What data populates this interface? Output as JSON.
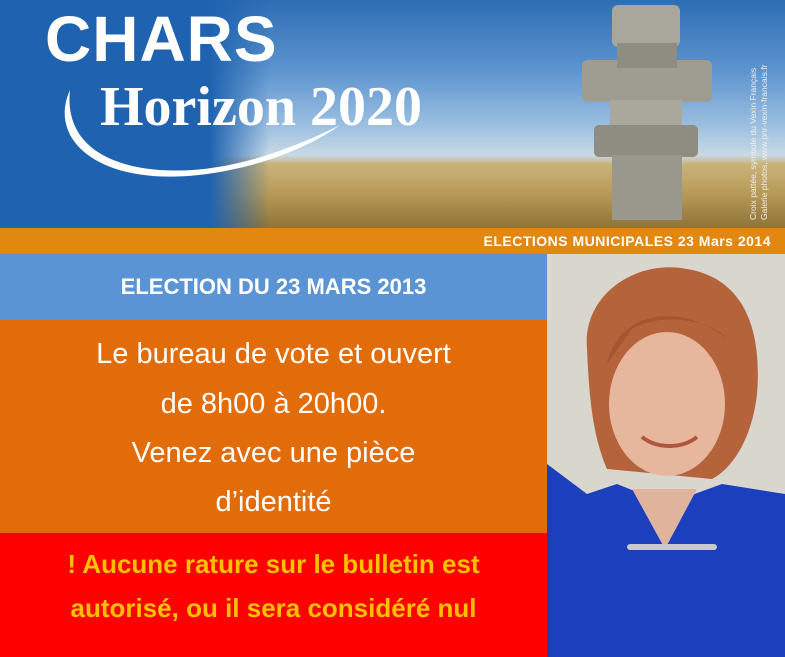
{
  "banner": {
    "brand_top": "CHARS",
    "brand_bottom": "Horizon 2020",
    "credit_line1": "Croix pattée, symbole du Vexin Français",
    "credit_line2": "Galerie photos, www.pnr-vexin-francais.fr"
  },
  "strip": {
    "text": "ELECTIONS MUNICIPALES 23 Mars 2014"
  },
  "title": {
    "text": "ELECTION DU 23 MARS 2013"
  },
  "info": {
    "lines": [
      "Le bureau de vote et ouvert",
      "de 8h00 à 20h00.",
      "Venez avec  une pièce",
      "d’identité"
    ]
  },
  "warning": {
    "lines": [
      "! Aucune rature sur le bulletin est",
      "autorisé, ou il sera considéré nul"
    ]
  },
  "colors": {
    "banner_blue": "#1f63b0",
    "strip_orange": "#e28710",
    "title_blue": "#5b94d5",
    "info_orange": "#e36c0a",
    "warning_red": "#fe0000",
    "warning_text": "#ffc000"
  }
}
